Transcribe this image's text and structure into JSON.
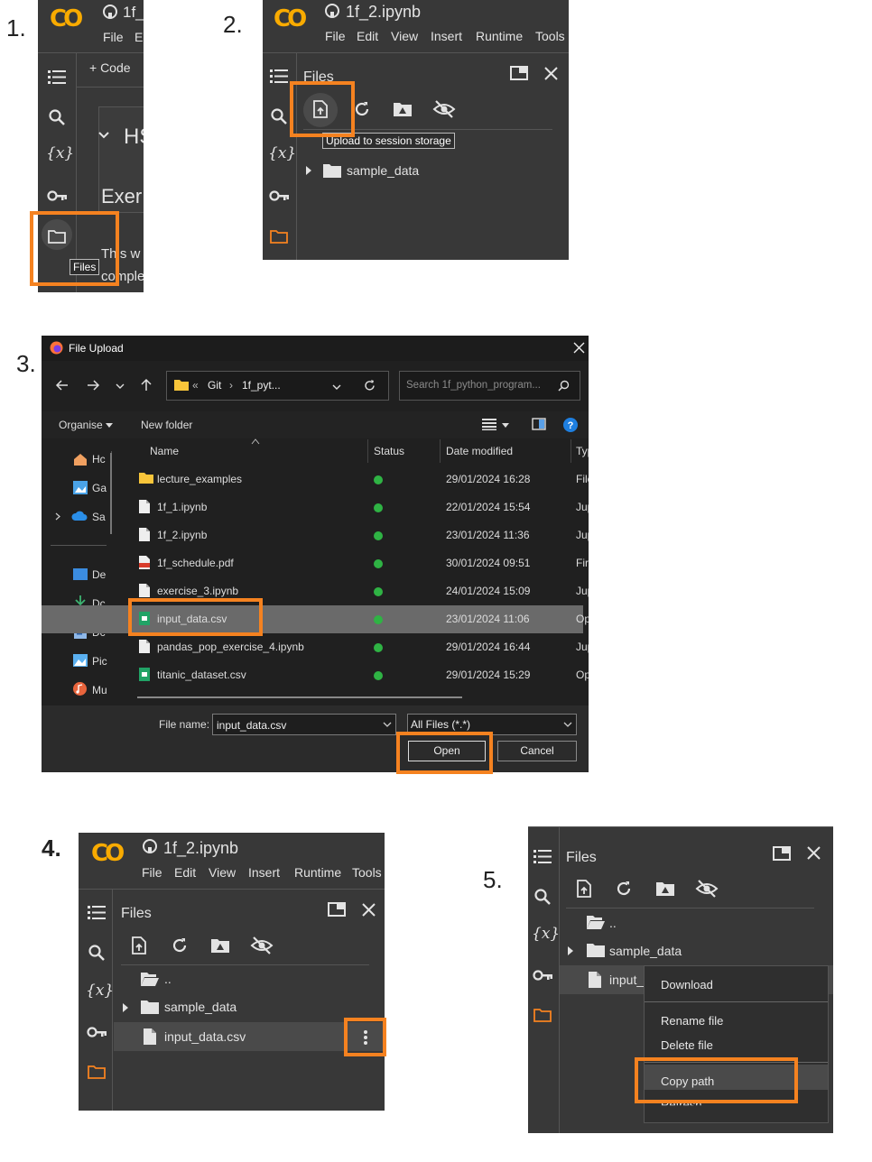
{
  "steps": [
    "1.",
    "2.",
    "3.",
    "4.",
    "5."
  ],
  "colab": {
    "logo": "CO",
    "notebook_title_short": "1f_",
    "notebook_title": "1f_2.ipynb",
    "menu": [
      "File",
      "Edit",
      "View",
      "Insert",
      "Runtime",
      "Tools"
    ],
    "menu_short": [
      "File",
      "E"
    ],
    "add_code": "+ Code",
    "section_heading": "HS",
    "exercise_text": "Exer",
    "body_line1": "This w",
    "body_line2": "comple",
    "files_tooltip": "Files",
    "variables_symbol": "{x}",
    "files_panel_title": "Files",
    "upload_tooltip": "Upload to session storage",
    "parent_dir": "..",
    "sample_data": "sample_data",
    "input_file": "input_data.csv",
    "input_file_truncated": "input_"
  },
  "dialog": {
    "title": "File Upload",
    "path": [
      "«",
      "Git",
      "›",
      "1f_pyt..."
    ],
    "search_placeholder": "Search 1f_python_program...",
    "organise": "Organise",
    "new_folder": "New folder",
    "columns": [
      "Name",
      "Status",
      "Date modified",
      "Typ"
    ],
    "nav": [
      "Hc",
      "Ga",
      "Sa",
      "De",
      "Dc",
      "Dc",
      "Pic",
      "Mu"
    ],
    "files": [
      {
        "name": "lecture_examples",
        "date": "29/01/2024 16:28",
        "type": "File",
        "icon": "folder"
      },
      {
        "name": "1f_1.ipynb",
        "date": "22/01/2024 15:54",
        "type": "Jup",
        "icon": "file"
      },
      {
        "name": "1f_2.ipynb",
        "date": "23/01/2024 11:36",
        "type": "Jup",
        "icon": "file"
      },
      {
        "name": "1f_schedule.pdf",
        "date": "30/01/2024 09:51",
        "type": "Fir",
        "icon": "pdf"
      },
      {
        "name": "exercise_3.ipynb",
        "date": "24/01/2024 15:09",
        "type": "Jup",
        "icon": "file"
      },
      {
        "name": "input_data.csv",
        "date": "23/01/2024 11:06",
        "type": "Op",
        "icon": "csv"
      },
      {
        "name": "pandas_pop_exercise_4.ipynb",
        "date": "29/01/2024 16:44",
        "type": "Jup",
        "icon": "file"
      },
      {
        "name": "titanic_dataset.csv",
        "date": "29/01/2024 15:29",
        "type": "Op",
        "icon": "csv"
      }
    ],
    "file_name_label": "File name:",
    "file_name_value": "input_data.csv",
    "filter_value": "All Files (*.*)",
    "open_label": "Open",
    "cancel_label": "Cancel"
  },
  "context_menu": {
    "items": [
      "Download",
      "Rename file",
      "Delete file",
      "Copy path",
      "Refresh"
    ]
  },
  "colors": {
    "highlight": "#f58220",
    "colab_bg": "#383838",
    "logo": "#f9ab00"
  }
}
